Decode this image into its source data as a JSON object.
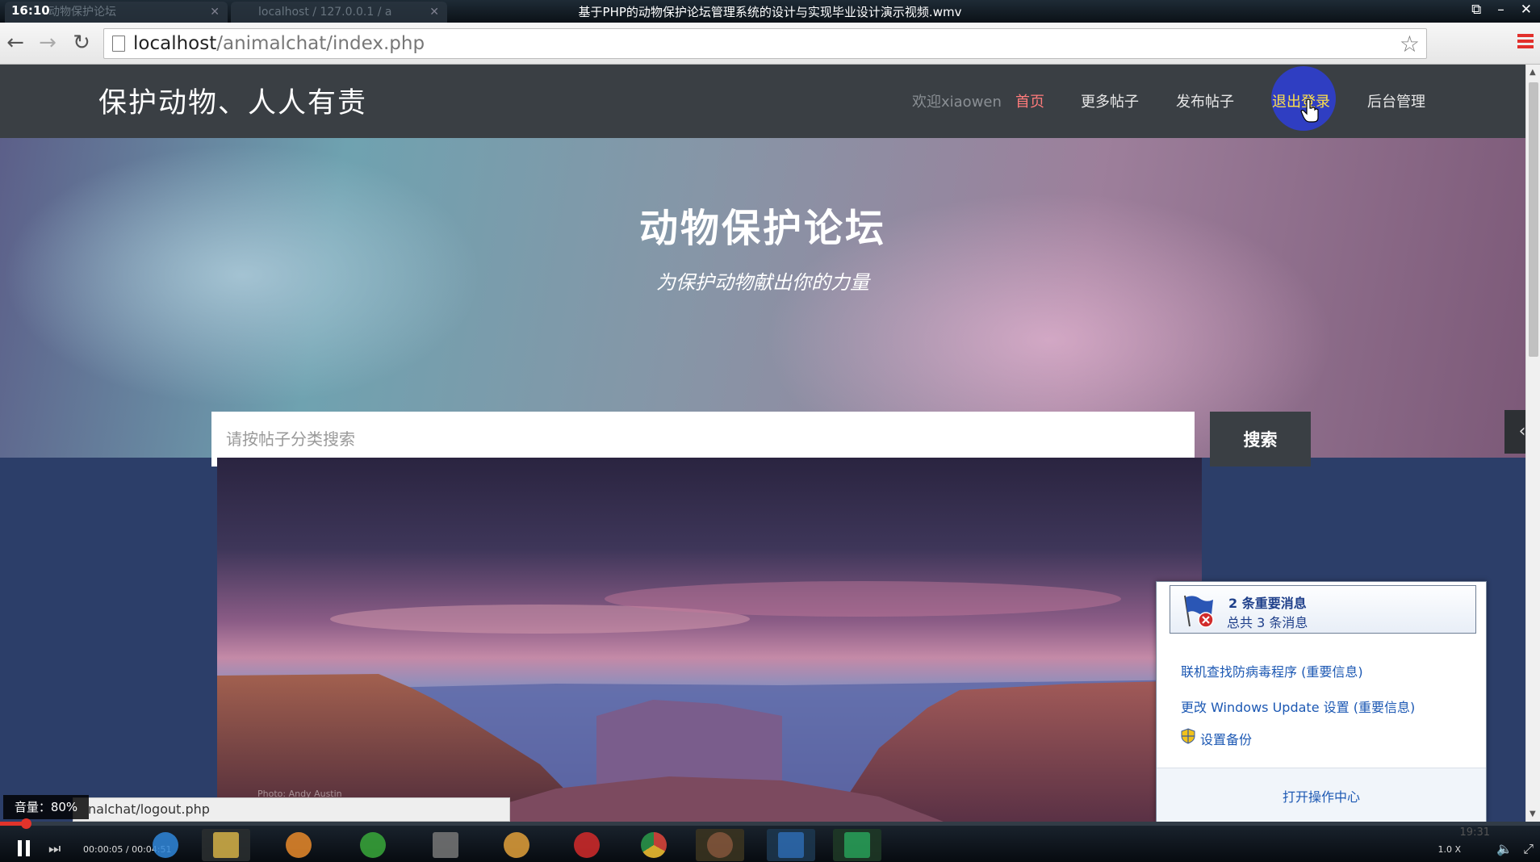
{
  "player": {
    "clock_left": "16:10",
    "window_title": "基于PHP的动物保护论坛管理系统的设计与实现毕业设计演示视频.wmv",
    "time_label": "00:00:05 / 00:04:51",
    "progress_fraction": 0.017,
    "speed": "1.0 X",
    "clock_right": "19:31",
    "volume_label": "音量：80%"
  },
  "browser": {
    "tabs": [
      {
        "label": "动物保护论坛"
      },
      {
        "label": "localhost / 127.0.0.1 / a"
      }
    ],
    "url_host": "localhost",
    "url_path": "/animalchat/index.php",
    "status_url": "nalchat/logout.php"
  },
  "site": {
    "brand": "保护动物、人人有责",
    "nav": {
      "welcome": "欢迎xiaowen",
      "home": "首页",
      "more_posts": "更多帖子",
      "publish_post": "发布帖子",
      "logout": "退出登录",
      "admin": "后台管理"
    },
    "hero": {
      "title": "动物保护论坛",
      "subtitle": "为保护动物献出你的力量"
    },
    "search": {
      "placeholder": "请按帖子分类搜索",
      "button": "搜索"
    },
    "photo_credit": "Photo: Andy Austin"
  },
  "action_center": {
    "headline": "2 条重要消息",
    "subline": "总共 3 条消息",
    "items": [
      {
        "label": "联机查找防病毒程序 (重要信息)"
      },
      {
        "label": "更改 Windows Update 设置 (重要信息)"
      },
      {
        "label": "设置备份"
      }
    ],
    "footer": "打开操作中心"
  },
  "colors": {
    "navbar": "#3a3f44",
    "active_nav": "#ff7b7b",
    "logout_highlight": "#2f3ec2",
    "progress": "#e1332b"
  }
}
